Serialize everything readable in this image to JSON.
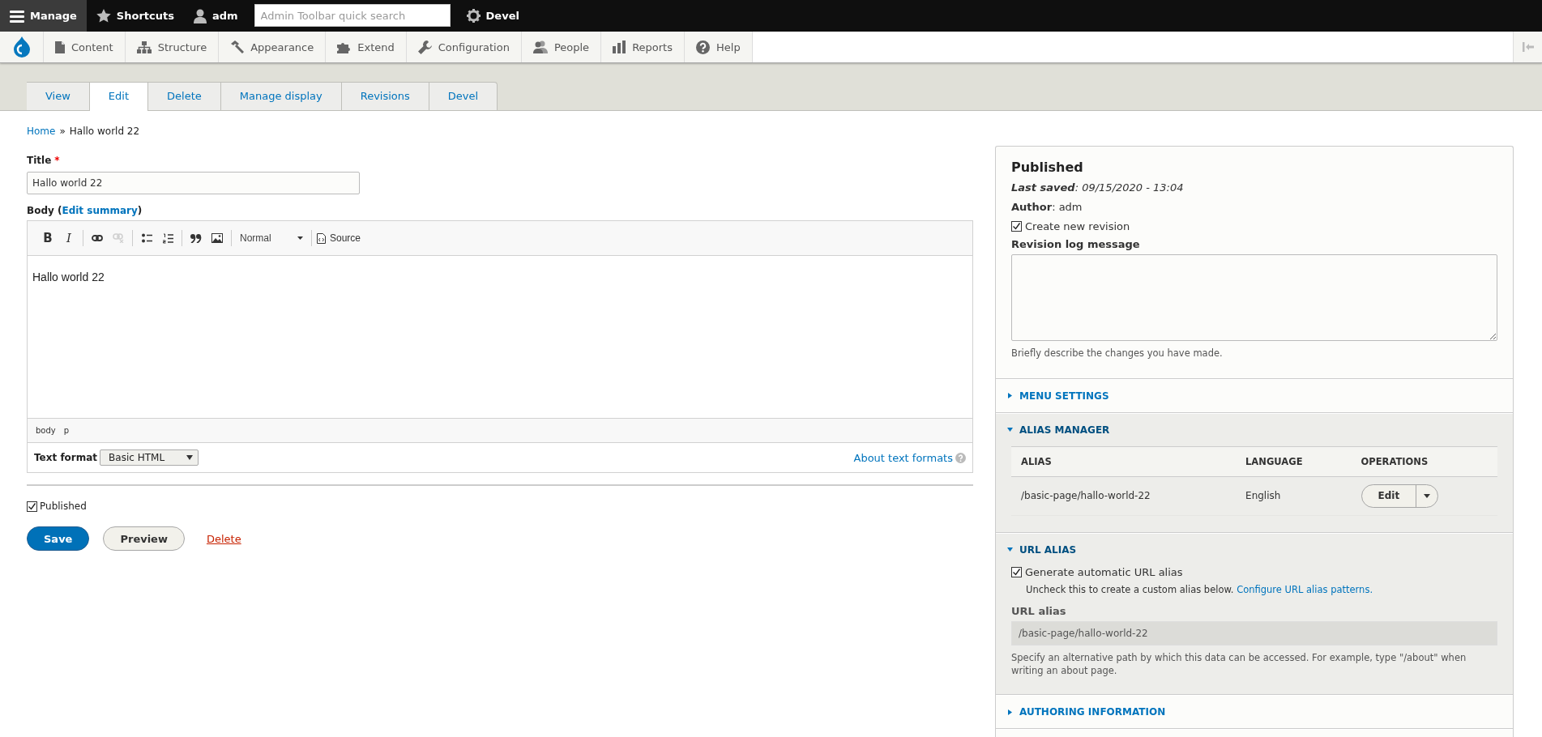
{
  "toolbar": {
    "items": [
      {
        "kind": "menu",
        "label": "Manage",
        "selected": true
      },
      {
        "kind": "star",
        "label": "Shortcuts",
        "selected": false
      },
      {
        "kind": "user",
        "label": "adm",
        "selected": false
      },
      {
        "kind": "search",
        "placeholder": "Admin Toolbar quick search"
      },
      {
        "kind": "gear",
        "label": "Devel",
        "selected": false
      }
    ]
  },
  "admin_menu": {
    "items": [
      {
        "kind": "content",
        "label": "Content"
      },
      {
        "kind": "structure",
        "label": "Structure"
      },
      {
        "kind": "appearance",
        "label": "Appearance"
      },
      {
        "kind": "extend",
        "label": "Extend"
      },
      {
        "kind": "configuration",
        "label": "Configuration"
      },
      {
        "kind": "people",
        "label": "People"
      },
      {
        "kind": "reports",
        "label": "Reports"
      },
      {
        "kind": "help",
        "label": "Help"
      }
    ]
  },
  "tabs": [
    {
      "label": "View",
      "selected": false
    },
    {
      "label": "Edit",
      "selected": true
    },
    {
      "label": "Delete",
      "selected": false
    },
    {
      "label": "Manage display",
      "selected": false
    },
    {
      "label": "Revisions",
      "selected": false
    },
    {
      "label": "Devel",
      "selected": false
    }
  ],
  "breadcrumb": {
    "links": [
      "Home"
    ],
    "separator": "»",
    "current": "Hallo world 22"
  },
  "title_field": {
    "label": "Title",
    "required_mark": "*",
    "value": "Hallo world 22"
  },
  "body_field": {
    "label_before": "Body (",
    "link": "Edit summary",
    "label_after": ")",
    "toolbar": [
      [
        {
          "kind": "bold",
          "glyph": "B",
          "disabled": false
        },
        {
          "kind": "italic",
          "glyph": "I",
          "disabled": false
        }
      ],
      [
        {
          "kind": "link",
          "disabled": false
        },
        {
          "kind": "unlink",
          "disabled": true
        }
      ],
      [
        {
          "kind": "bulleted-list",
          "disabled": false
        },
        {
          "kind": "numbered-list",
          "disabled": false
        }
      ],
      [
        {
          "kind": "blockquote",
          "disabled": false
        },
        {
          "kind": "image",
          "disabled": false
        }
      ]
    ],
    "format": "Normal",
    "source": "Source",
    "content": "Hallo world 22",
    "path": [
      "body",
      "p"
    ],
    "text_format_label": "Text format",
    "text_format": "Basic HTML",
    "about_link": "About text formats"
  },
  "published": {
    "label": "Published",
    "checked": true
  },
  "actions": [
    {
      "kind": "primary",
      "label": "Save"
    },
    {
      "kind": "secondary",
      "label": "Preview"
    },
    {
      "kind": "danger-link",
      "label": "Delete"
    }
  ],
  "sidebar": {
    "status": "Published",
    "last_saved": "**Last saved**: 09/15/2020 - 13:04",
    "author": "**Author**: adm",
    "create_revision": {
      "label": "Create new revision",
      "checked": true
    },
    "log_label": "Revision log message",
    "log_description": "Briefly describe the changes you have made.",
    "sections": [
      {
        "title": "MENU SETTINGS",
        "expanded": false
      },
      {
        "kind": "alias-table",
        "title": "ALIAS MANAGER",
        "expanded": true,
        "columns": [
          "ALIAS",
          "LANGUAGE",
          "OPERATIONS"
        ],
        "rows": [
          {
            "alias": "/basic-page/hallo-world-22",
            "language": "English",
            "operation": "Edit"
          }
        ]
      },
      {
        "kind": "url-alias",
        "title": "URL ALIAS",
        "expanded": true,
        "checkbox": {
          "label": "Generate automatic URL alias",
          "checked": true
        },
        "hint": "Uncheck this to create a custom alias below.",
        "hint_link": "Configure URL alias patterns.",
        "field_label": "URL alias",
        "field_value": "/basic-page/hallo-world-22",
        "field_disabled": true,
        "description": "Specify an alternative path by which this data can be accessed. For example, type \"/about\" when writing an about page."
      },
      {
        "title": "AUTHORING INFORMATION",
        "expanded": false
      }
    ]
  }
}
